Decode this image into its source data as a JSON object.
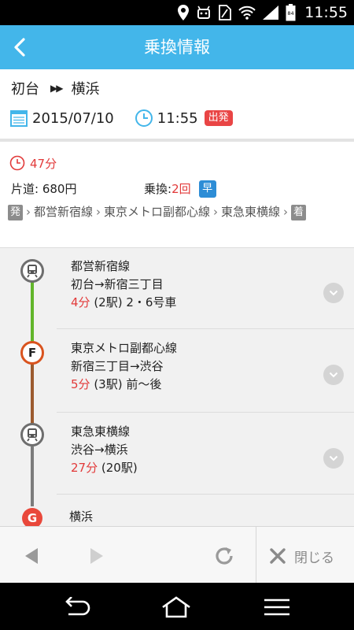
{
  "status_bar": {
    "time": "11:55",
    "battery_level": "84",
    "icons": [
      "location-icon",
      "android-icon",
      "sim-icon",
      "wifi-icon",
      "signal-icon",
      "battery-icon"
    ]
  },
  "header": {
    "title": "乗換情報"
  },
  "search": {
    "from": "初台",
    "to": "横浜",
    "date": "2015/07/10",
    "time": "11:55",
    "mode_badge": "出発"
  },
  "summary": {
    "duration": "47分",
    "fare_label": "片道:",
    "fare_value": "680円",
    "transfer_label": "乗換:",
    "transfer_count": "2回",
    "fast_badge": "早",
    "depart_tag": "発",
    "arrive_tag": "着",
    "lines": [
      "都営新宿線",
      "東京メトロ副都心線",
      "東急東横線"
    ]
  },
  "segments": [
    {
      "line": "都営新宿線",
      "section": "初台→新宿三丁目",
      "minutes": "4分",
      "extra": "(2駅) 2・6号車",
      "color": "#62b52a"
    },
    {
      "line": "東京メトロ副都心線",
      "section": "新宿三丁目→渋谷",
      "minutes": "5分",
      "extra": "(3駅) 前〜後",
      "color": "#9c5b2f"
    },
    {
      "line": "東急東横線",
      "section": "渋谷→横浜",
      "minutes": "27分",
      "extra": "(20駅)",
      "color": "#7c7c7c"
    }
  ],
  "segment_node_letter": "F",
  "goal": {
    "letter": "G",
    "name": "横浜"
  },
  "toolbar": {
    "close_label": "閉じる"
  },
  "colors": {
    "header_bg": "#43b6ea",
    "accent_red": "#e23a3a",
    "badge_blue": "#2d8dd6"
  }
}
